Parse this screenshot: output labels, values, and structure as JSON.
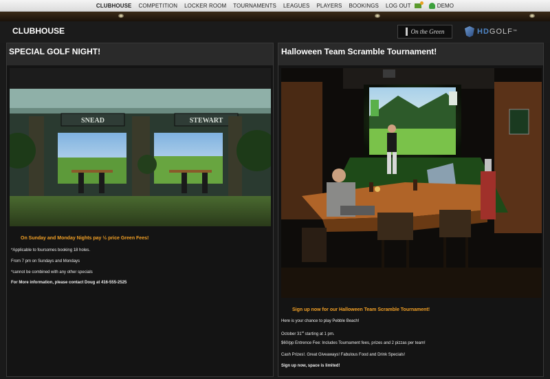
{
  "nav": {
    "items": [
      "CLUBHOUSE",
      "COMPETITION",
      "LOCKER ROOM",
      "TOURNAMENTS",
      "LEAGUES",
      "PLAYERS",
      "BOOKINGS",
      "LOG OUT"
    ],
    "user": "DEMO",
    "mail_icon": "mail-icon",
    "user_icon": "user-icon"
  },
  "header": {
    "title": "CLUBHOUSE",
    "logo_green": "On the Green",
    "logo_hd_prefix": "HD",
    "logo_hd_suffix": "GOLF",
    "logo_hd_tm": "™"
  },
  "left_panel": {
    "title": "SPECIAL GOLF NIGHT!",
    "sign_left": "SNEAD",
    "sign_right": "STEWART",
    "headline": "On Sunday and Monday Nights pay ½ price Green Fees!",
    "line1": "*Applicable to foursomes booking 18 holes.",
    "line2": "From 7 pm on Sundays and Mondays",
    "line3": " *cannot be combined with any other specials",
    "line4": "For More information, please contact Doug at 416-555-2525"
  },
  "right_panel": {
    "title": "Halloween Team Scramble Tournament!",
    "headline": "Sign up now for our Halloween Team Scramble Tournament!",
    "line1": "Here is your chance to play Pebble Beach!",
    "line2_prefix": "October 31",
    "line2_sup": "st",
    "line2_suffix": " starting at 1 pm.",
    "line3": "$60/pp Entrence Fee: Includes Tournament fees, prizes and 2 pizzas per team!",
    "line4": "Cash Prizes!. Great Giveaways! Fabulous Food and Drink Specials!",
    "line5": " Sign up now, space is limited!"
  },
  "colors": {
    "accent": "#f3a126",
    "nav_bg": "#e8e8e8",
    "panel_title_bg": "#2a2a2a"
  }
}
